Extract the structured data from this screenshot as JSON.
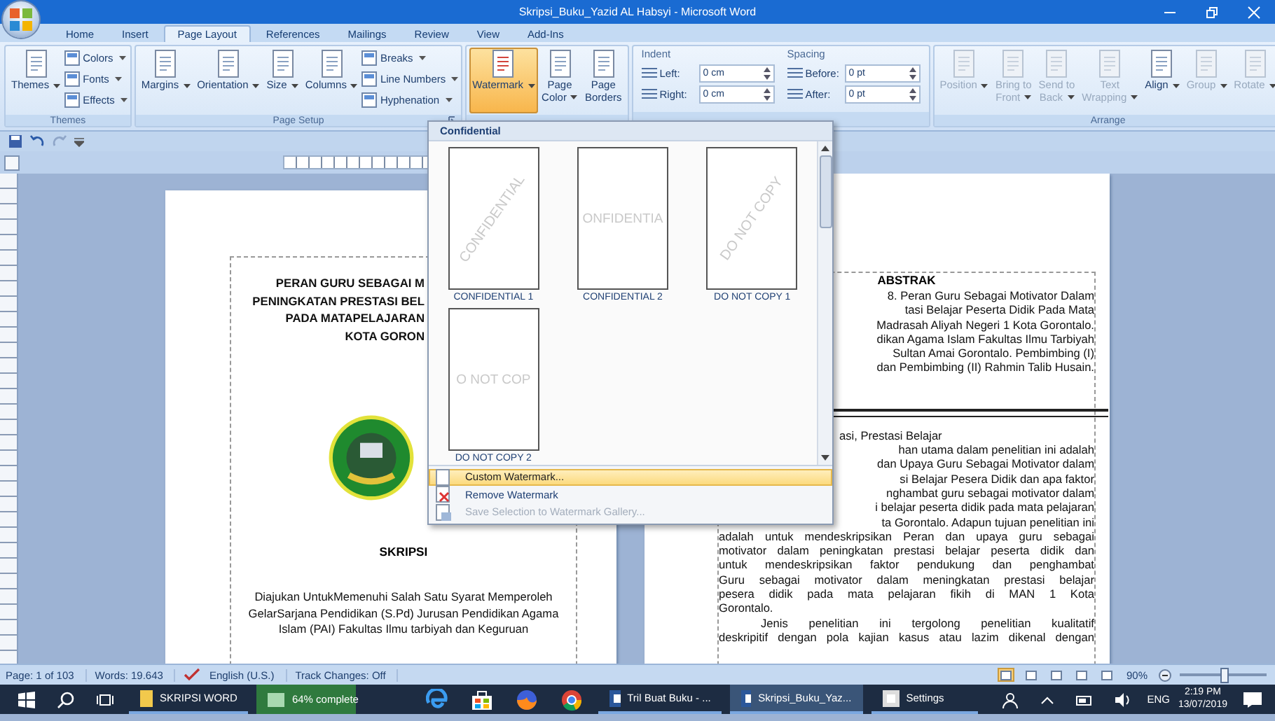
{
  "window": {
    "title": "Skripsi_Buku_Yazid AL Habsyi - Microsoft Word"
  },
  "tabs": [
    {
      "label": "Home",
      "selected": false
    },
    {
      "label": "Insert",
      "selected": false
    },
    {
      "label": "Page Layout",
      "selected": true
    },
    {
      "label": "References",
      "selected": false
    },
    {
      "label": "Mailings",
      "selected": false
    },
    {
      "label": "Review",
      "selected": false
    },
    {
      "label": "View",
      "selected": false
    },
    {
      "label": "Add-Ins",
      "selected": false
    }
  ],
  "ribbon": [
    {
      "label": "Themes",
      "launcher": false,
      "items": [
        {
          "kind": "big",
          "lines": [
            "Themes"
          ],
          "dropdown": true,
          "pressed": false,
          "disabled": false
        },
        {
          "kind": "stack",
          "buttons": [
            {
              "label": "Colors",
              "disabled": false
            },
            {
              "label": "Fonts",
              "disabled": false
            },
            {
              "label": "Effects",
              "disabled": false
            }
          ]
        }
      ]
    },
    {
      "label": "Page Setup",
      "launcher": true,
      "items": [
        {
          "kind": "big",
          "lines": [
            "Margins"
          ],
          "dropdown": true,
          "pressed": false,
          "disabled": false
        },
        {
          "kind": "big",
          "lines": [
            "Orientation"
          ],
          "dropdown": true,
          "pressed": false,
          "disabled": false
        },
        {
          "kind": "big",
          "lines": [
            "Size"
          ],
          "dropdown": true,
          "pressed": false,
          "disabled": false
        },
        {
          "kind": "big",
          "lines": [
            "Columns"
          ],
          "dropdown": true,
          "pressed": false,
          "disabled": false
        },
        {
          "kind": "stack",
          "buttons": [
            {
              "label": "Breaks",
              "disabled": false
            },
            {
              "label": "Line Numbers",
              "disabled": false
            },
            {
              "label": "Hyphenation",
              "disabled": false
            }
          ]
        }
      ]
    },
    {
      "items": [
        {
          "kind": "big",
          "lines": [
            "Watermark"
          ],
          "dropdown": true,
          "pressed": true,
          "disabled": false
        },
        {
          "kind": "big",
          "lines": [
            "Page",
            "Color"
          ],
          "dropdown": true,
          "pressed": false,
          "disabled": false
        },
        {
          "kind": "big",
          "lines": [
            "Page",
            "Borders"
          ],
          "dropdown": false,
          "pressed": false,
          "disabled": false
        }
      ]
    },
    {
      "items": [
        {
          "kind": "spins",
          "heading": "Indent",
          "fields": [
            {
              "label": "Left:",
              "value": "0 cm"
            },
            {
              "label": "Right:",
              "value": "0 cm"
            }
          ]
        },
        {
          "kind": "spins",
          "heading": "Spacing",
          "fields": [
            {
              "label": "Before:",
              "value": "0 pt"
            },
            {
              "label": "After:",
              "value": "0 pt"
            }
          ]
        }
      ]
    },
    {
      "label": "Arrange",
      "launcher": false,
      "items": [
        {
          "kind": "big",
          "lines": [
            "Position"
          ],
          "dropdown": true,
          "pressed": false,
          "disabled": true
        },
        {
          "kind": "big",
          "lines": [
            "Bring to",
            "Front"
          ],
          "dropdown": true,
          "pressed": false,
          "disabled": true
        },
        {
          "kind": "big",
          "lines": [
            "Send to",
            "Back"
          ],
          "dropdown": true,
          "pressed": false,
          "disabled": true
        },
        {
          "kind": "big",
          "lines": [
            "Text",
            "Wrapping"
          ],
          "dropdown": true,
          "pressed": false,
          "disabled": true
        },
        {
          "kind": "big",
          "lines": [
            "Align"
          ],
          "dropdown": true,
          "pressed": false,
          "disabled": false
        },
        {
          "kind": "big",
          "lines": [
            "Group"
          ],
          "dropdown": true,
          "pressed": false,
          "disabled": true
        },
        {
          "kind": "big",
          "lines": [
            "Rotate"
          ],
          "dropdown": true,
          "pressed": false,
          "disabled": true
        }
      ]
    }
  ],
  "left_page": {
    "title_lines": [
      "PERAN GURU SEBAGAI M",
      "PENINGKATAN PRESTASI BEL",
      "PADA MATAPELAJARAN",
      "KOTA GORON"
    ],
    "heading": "SKRIPSI",
    "lines": [
      "Diajukan UntukMemenuhi Salah Satu Syarat Memperoleh",
      "GelarSarjana Pendidikan (S.Pd) Jurusan Pendidikan Agama",
      "Islam (PAI) Fakultas Ilmu tarbiyah dan Keguruan"
    ]
  },
  "right_page": {
    "heading": "ABSTRAK",
    "abstract_lines": [
      {
        "kind": "cut",
        "text": "8. Peran Guru Sebagai Motivator Dalam"
      },
      {
        "kind": "cut",
        "text": "tasi Belajar Peserta Didik Pada Mata"
      },
      {
        "kind": "cut",
        "text": "Madrasah Aliyah Negeri 1 Kota Gorontalo."
      },
      {
        "kind": "cut",
        "text": "dikan Agama Islam Fakultas Ilmu Tarbiyah"
      },
      {
        "kind": "cut",
        "text": "Sultan Amai Gorontalo. Pembimbing (I)"
      },
      {
        "kind": "cut",
        "text": "dan Pembimbing (II) Rahmin Talib Husain."
      }
    ],
    "body_lines": [
      {
        "kind": "cut-left",
        "text": "asi, Prestasi Belajar"
      },
      {
        "kind": "cut",
        "text": "han utama dalam penelitian ini adalah"
      },
      {
        "kind": "cut",
        "text": "dan Upaya Guru Sebagai Motivator dalam"
      },
      {
        "kind": "cut",
        "text": "si Belajar Pesera Didik dan apa faktor"
      },
      {
        "kind": "cut",
        "text": "nghambat guru sebagai motivator dalam"
      },
      {
        "kind": "cut",
        "text": "i belajar peserta didik pada mata pelajaran"
      },
      {
        "kind": "cut",
        "text": "ta Gorontalo. Adapun tujuan penelitian ini"
      },
      {
        "kind": "full",
        "text": "adalah untuk mendeskripsikan Peran dan upaya guru sebagai"
      },
      {
        "kind": "full",
        "text": "motivator dalam peningkatan prestasi belajar peserta didik dan"
      },
      {
        "kind": "full",
        "text": "untuk mendeskripsikan faktor pendukung dan penghambat"
      },
      {
        "kind": "full",
        "text": "Guru sebagai motivator dalam meningkatan prestasi belajar"
      },
      {
        "kind": "full",
        "text": "pesera didik pada mata pelajaran fikih di MAN 1 Kota"
      },
      {
        "kind": "last",
        "text": "Gorontalo."
      },
      {
        "kind": "indent",
        "text": "Jenis penelitian ini tergolong penelitian kualitatif"
      },
      {
        "kind": "full",
        "text": "deskripitif dengan pola kajian kasus atau lazim dikenal dengan"
      }
    ]
  },
  "watermark_menu": {
    "header": "Confidential",
    "thumbnails": [
      {
        "caption": "CONFIDENTIAL 1",
        "sample": "CONFIDENTIAL",
        "kind": "diagonal"
      },
      {
        "caption": "CONFIDENTIAL 2",
        "sample": "ONFIDENTIA",
        "kind": "horizontal"
      },
      {
        "caption": "DO NOT COPY 1",
        "sample": "DO NOT COPY",
        "kind": "diagonal"
      },
      {
        "caption": "DO NOT COPY 2",
        "sample": "O NOT COP",
        "kind": "horizontal"
      }
    ],
    "items": [
      {
        "label": "Custom Watermark...",
        "selected": true,
        "disabled": false
      },
      {
        "label": "Remove Watermark",
        "selected": false,
        "disabled": false
      },
      {
        "label": "Save Selection to Watermark Gallery...",
        "selected": false,
        "disabled": true
      }
    ]
  },
  "status_bar": {
    "page": "Page: 1 of 103",
    "words": "Words: 19.643",
    "language": "English (U.S.)",
    "track_changes": "Track Changes: Off",
    "zoom": "90%",
    "views": [
      {
        "selected": true
      },
      {
        "selected": false
      },
      {
        "selected": false
      },
      {
        "selected": false
      },
      {
        "selected": false
      }
    ],
    "zoom_slider": {
      "level": 0.5
    }
  },
  "taskbar": {
    "folder": {
      "label": "SKRIPSI WORD"
    },
    "progress": {
      "label": "64% complete",
      "level": 0.64
    },
    "tasks": [
      {
        "label": "Tril Buat Buku - ...",
        "selected": false
      },
      {
        "label": "Skripsi_Buku_Yaz...",
        "selected": true
      },
      {
        "label": "Settings",
        "selected": false
      }
    ],
    "language": "ENG",
    "time": "2:19 PM",
    "date": "13/07/2019"
  }
}
